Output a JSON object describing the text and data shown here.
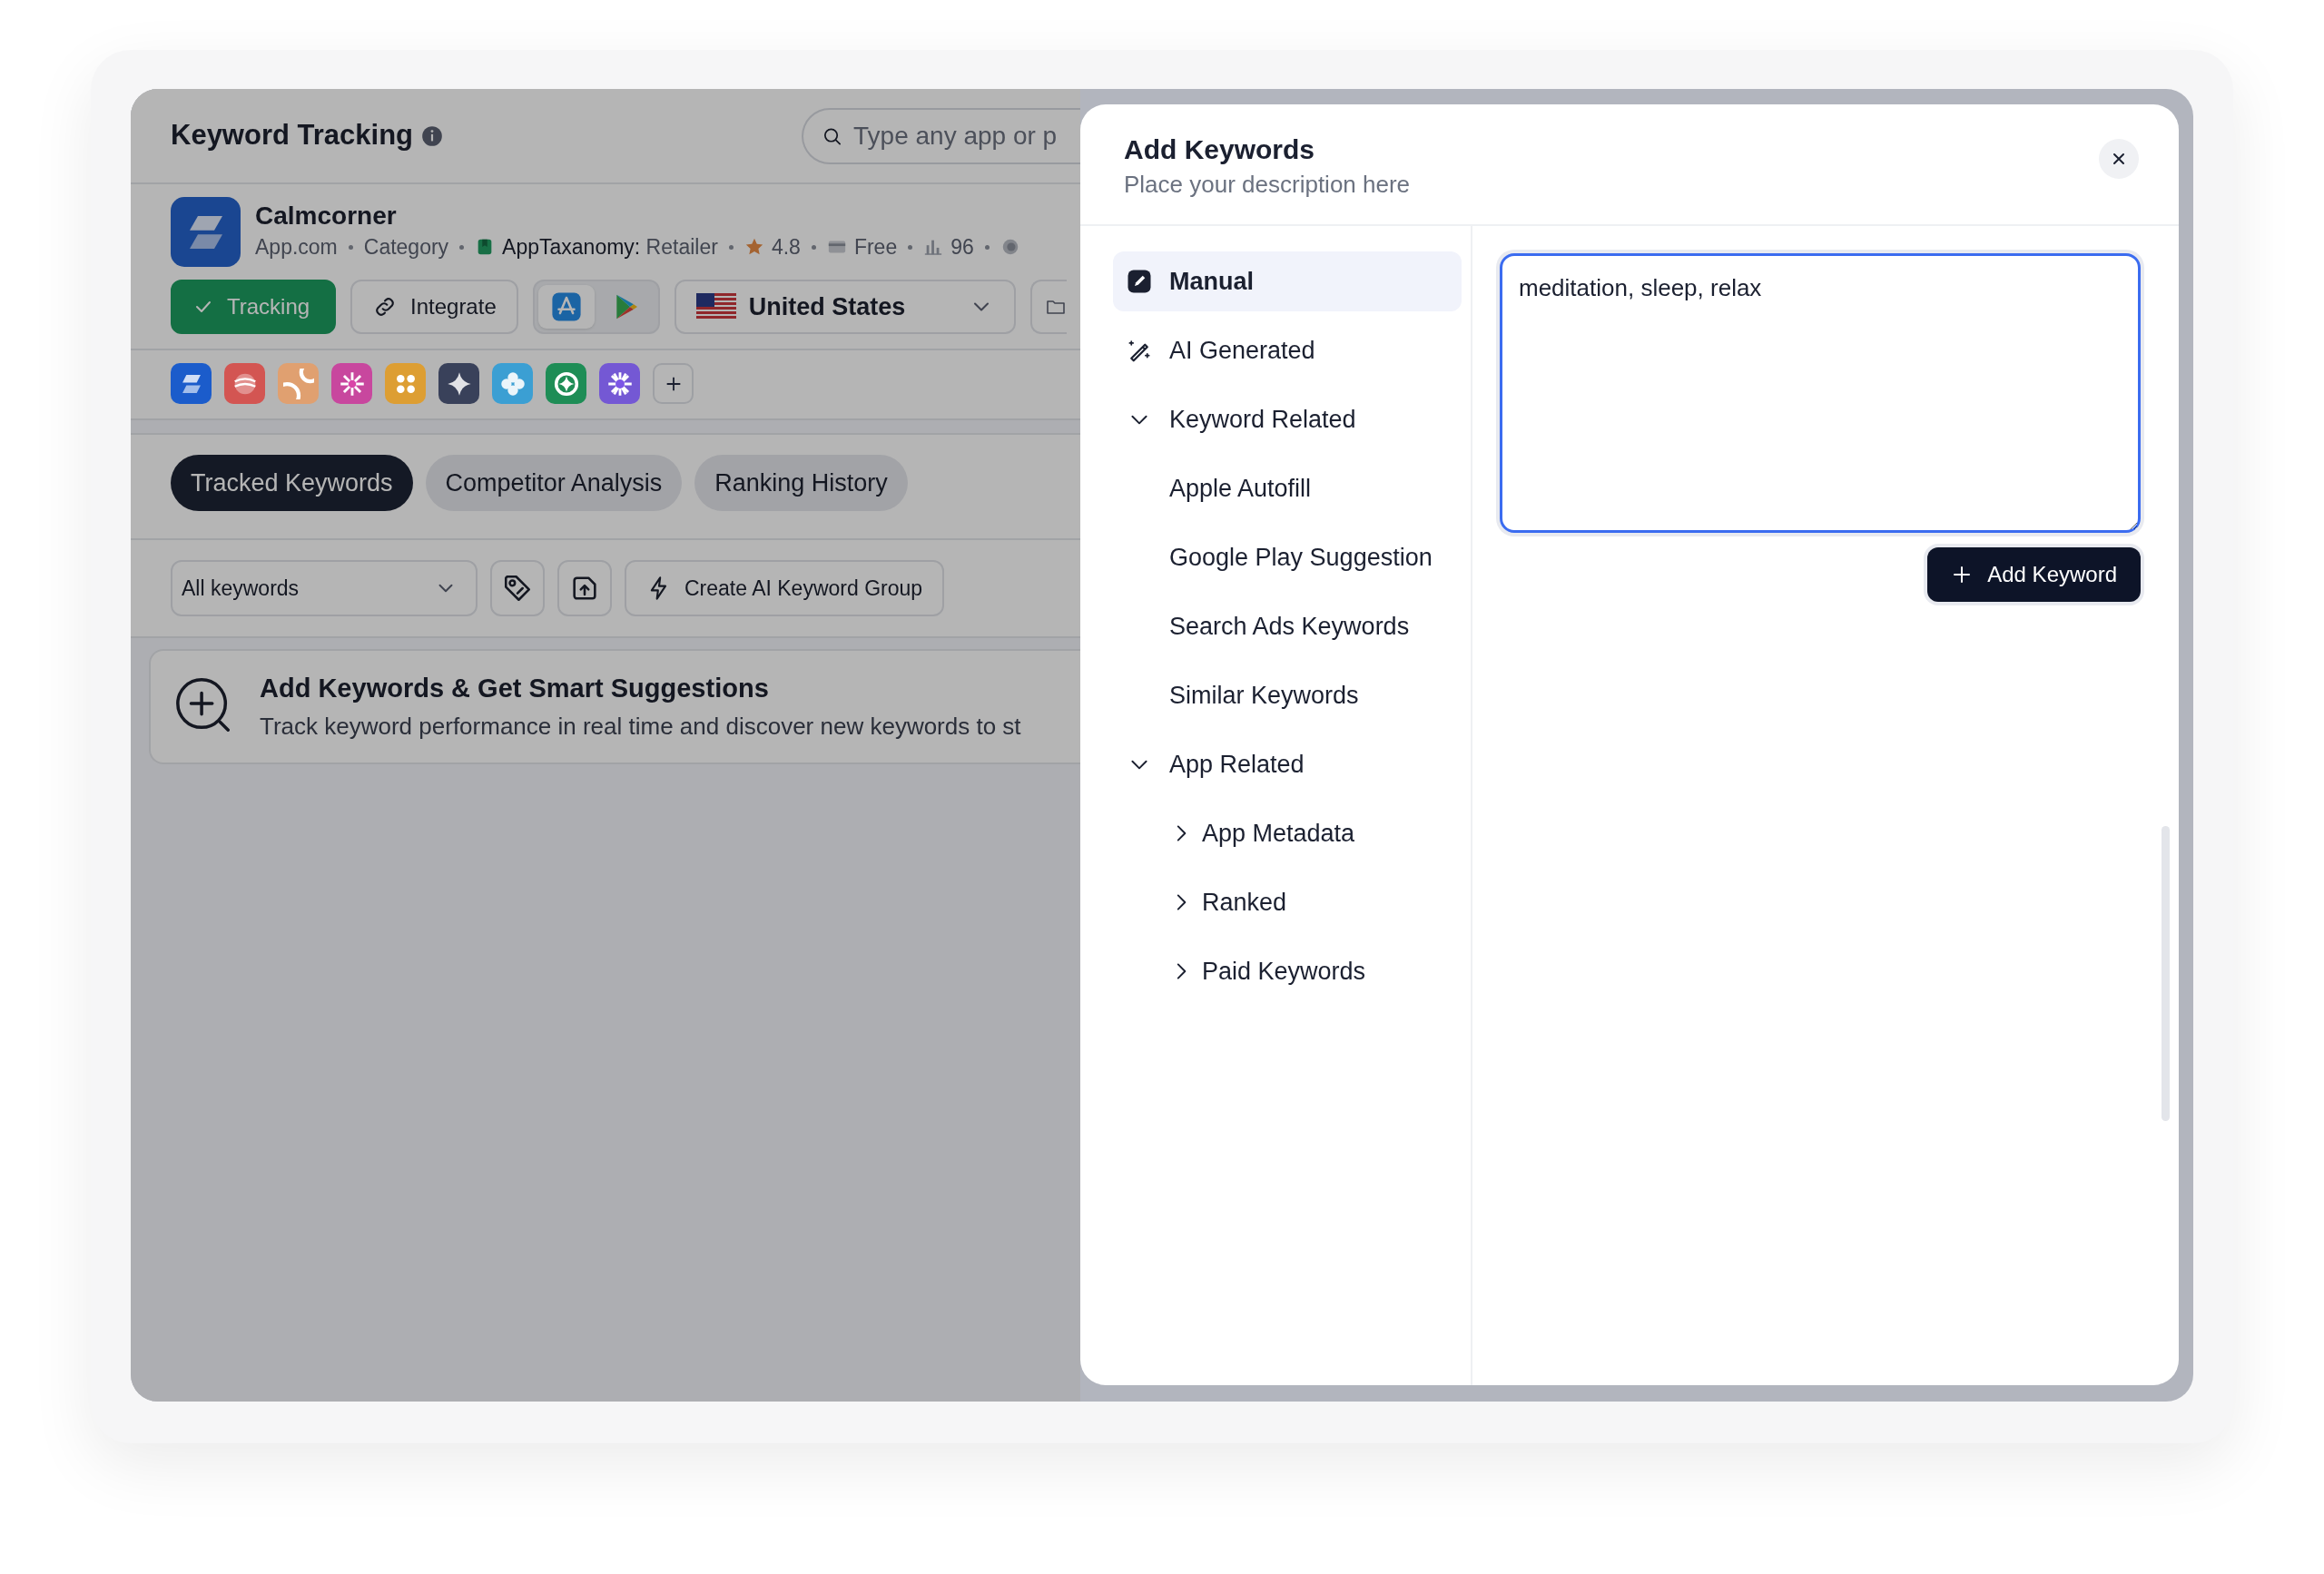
{
  "header": {
    "title": "Keyword Tracking",
    "search": {
      "placeholder": "Type any app or p"
    }
  },
  "app": {
    "name": "Calmcorner",
    "meta": [
      {
        "kind": "text",
        "text": "App.com"
      },
      {
        "kind": "text",
        "text": "Category"
      },
      {
        "kind": "taxonomy",
        "label": "AppTaxanomy:",
        "value": "Retailer"
      },
      {
        "kind": "rating",
        "text": "4.8"
      },
      {
        "kind": "price",
        "text": "Free"
      },
      {
        "kind": "rank",
        "text": "96"
      },
      {
        "kind": "ring"
      }
    ]
  },
  "actions": {
    "tracking": {
      "label": "Tracking",
      "on": true
    },
    "integrate": "Integrate",
    "stores": [
      {
        "kind": "appstore",
        "selected": true
      },
      {
        "kind": "googleplay",
        "selected": false
      }
    ],
    "country": "United States"
  },
  "competitors": [
    {
      "color": "#1b5ccb"
    },
    {
      "color": "#d35552"
    },
    {
      "color": "#e0a070"
    },
    {
      "color": "#c8479e"
    },
    {
      "color": "#dd9e33"
    },
    {
      "color": "#39415a"
    },
    {
      "color": "#3b9fd3"
    },
    {
      "color": "#1e8d56"
    },
    {
      "color": "#7458d4"
    }
  ],
  "tabs": [
    {
      "label": "Tracked Keywords",
      "selected": true
    },
    {
      "label": "Competitor Analysis",
      "selected": false
    },
    {
      "label": "Ranking History",
      "selected": false
    }
  ],
  "filter": {
    "value": "All keywords",
    "action": "Create AI Keyword Group"
  },
  "banner": {
    "title": "Add Keywords & Get Smart Suggestions",
    "text": "Track keyword performance in real time and discover new keywords to st"
  },
  "modal": {
    "title": "Add Keywords",
    "description": "Place your description here",
    "menu": [
      {
        "kind": "manual",
        "label": "Manual",
        "selected": true
      },
      {
        "kind": "ai",
        "label": "AI Generated",
        "selected": false
      },
      {
        "kind": "group",
        "label": "Keyword Related",
        "selected": false,
        "expanded": true,
        "children": [
          {
            "label": "Apple Autofill",
            "selected": false
          },
          {
            "label": "Google Play Suggestion",
            "selected": false
          },
          {
            "label": "Search Ads Keywords",
            "selected": false
          },
          {
            "label": "Similar Keywords",
            "selected": false
          }
        ]
      },
      {
        "kind": "group",
        "label": "App Related",
        "selected": false,
        "expanded": true,
        "children": [
          {
            "label": "App Metadata",
            "selected": false,
            "expanded": false
          },
          {
            "label": "Ranked",
            "selected": false,
            "expanded": false
          },
          {
            "label": "Paid Keywords",
            "selected": false,
            "expanded": false
          }
        ]
      }
    ],
    "input": {
      "value": "meditation, sleep, relax"
    },
    "submit": "Add Keyword"
  }
}
